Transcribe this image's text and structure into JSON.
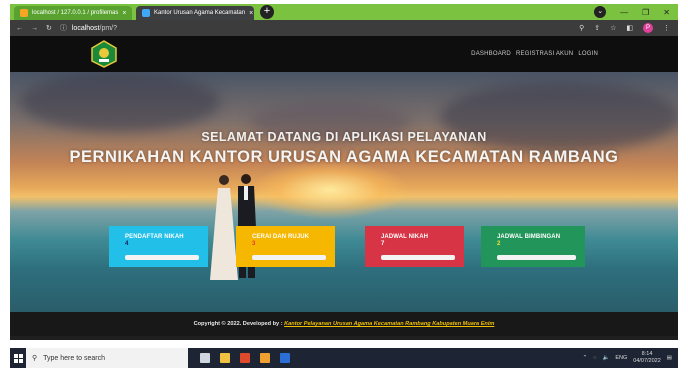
{
  "browser": {
    "tabs": [
      {
        "label": "localhost / 127.0.0.1 / profilemas",
        "close": "×",
        "favicon_color": "#f5a623"
      },
      {
        "label": "Kantor Urusan Agama Kecamatan",
        "close": "×",
        "favicon_color": "#3fa9f5"
      }
    ],
    "new_tab": "+",
    "url_prefix": "localhost",
    "url_rest": "/pm/?",
    "profile_initial": "P"
  },
  "site": {
    "nav_links": [
      "DASHBOARD",
      "REGISTRASI AKUN",
      "LOGIN"
    ],
    "hero_title_1": "SELAMAT DATANG DI APLIKASI PELAYANAN",
    "hero_title_2": "PERNIKAHAN KANTOR URUSAN AGAMA KECAMATAN RAMBANG",
    "cards": [
      {
        "label": "PENDAFTAR NIKAH",
        "value": "4"
      },
      {
        "label": "CERAI DAN RUJUK",
        "value": "3"
      },
      {
        "label": "JADWAL NIKAH",
        "value": "7"
      },
      {
        "label": "JADWAL BIMBINGAN",
        "value": "2"
      }
    ],
    "footer_text": "Copyright © 2022. Developed by :",
    "footer_link": "Kantor Pelayanan Urusan Agama Kecamatan Rambang Kabupaten Muara Enim"
  },
  "taskbar": {
    "search_placeholder": "Type here to search",
    "lang": "ENG",
    "time": "8:14",
    "date": "04/07/2022"
  },
  "colors": {
    "tabbar": "#7cc241",
    "card_1": "#22bfe8",
    "card_2": "#f6b700",
    "card_3": "#d73445",
    "card_4": "#22955a",
    "footer_link": "#f0c000"
  }
}
